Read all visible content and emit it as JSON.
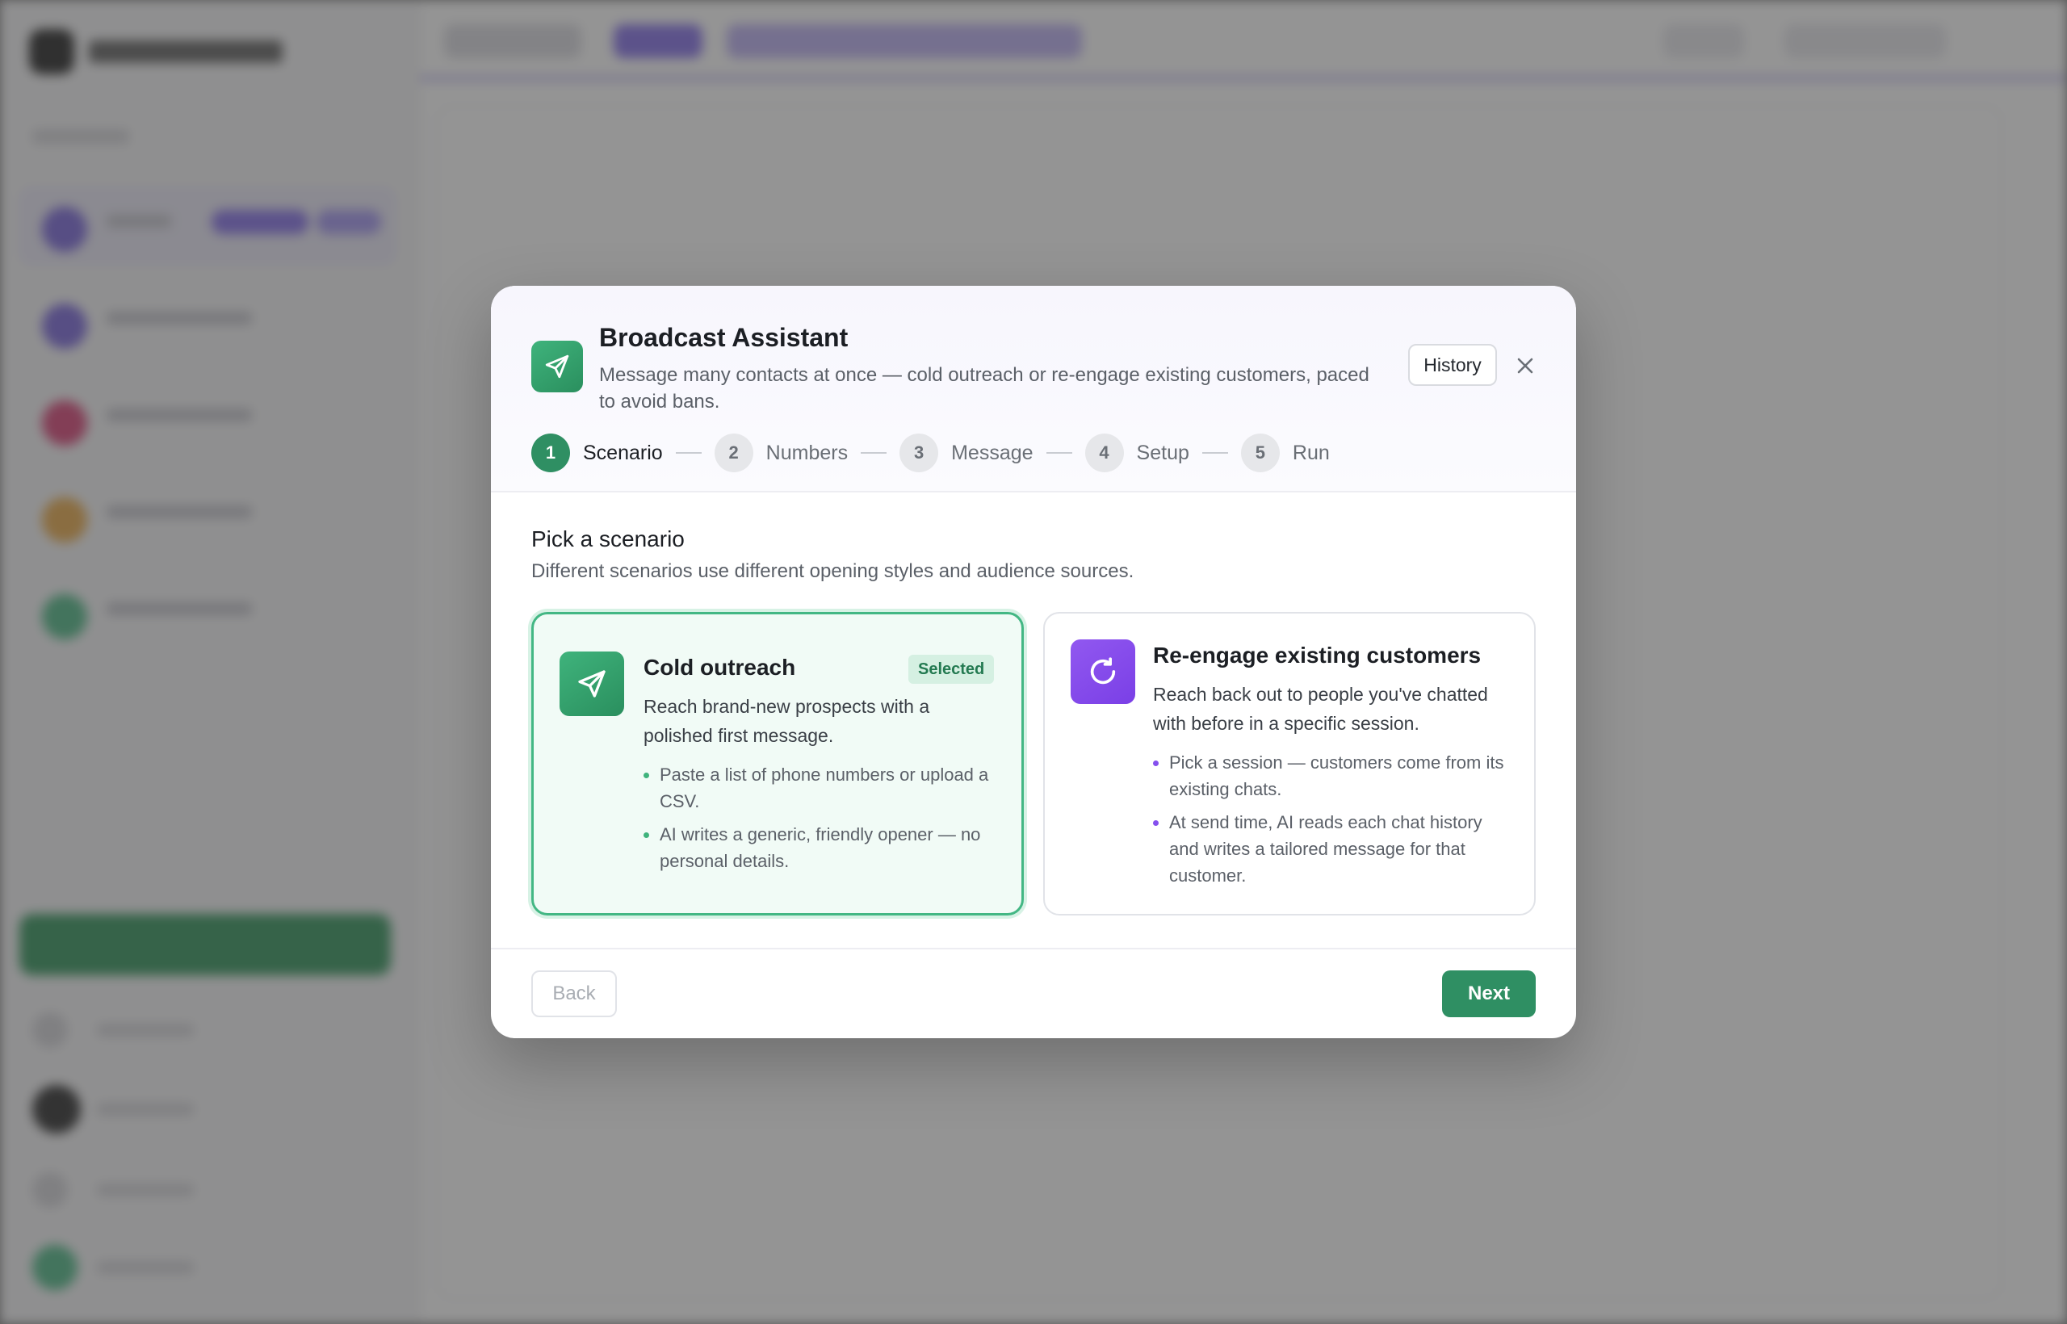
{
  "modal": {
    "title": "Broadcast Assistant",
    "subtitle": "Message many contacts at once — cold outreach or re-engage existing customers, paced to avoid bans.",
    "icon": "send-icon",
    "history_label": "History",
    "close_icon": "close-icon"
  },
  "steps": [
    {
      "number": "1",
      "label": "Scenario",
      "active": true
    },
    {
      "number": "2",
      "label": "Numbers",
      "active": false
    },
    {
      "number": "3",
      "label": "Message",
      "active": false
    },
    {
      "number": "4",
      "label": "Setup",
      "active": false
    },
    {
      "number": "5",
      "label": "Run",
      "active": false
    }
  ],
  "section": {
    "title": "Pick a scenario",
    "description": "Different scenarios use different opening styles and audience sources."
  },
  "scenarios": [
    {
      "title": "Cold outreach",
      "icon": "send-icon",
      "badge": "Selected",
      "selected": true,
      "description": "Reach brand-new prospects with a polished first message.",
      "bullets": [
        "Paste a list of phone numbers or upload a CSV.",
        "AI writes a generic, friendly opener — no personal details."
      ]
    },
    {
      "title": "Re-engage existing customers",
      "icon": "refresh-icon",
      "selected": false,
      "description": "Reach back out to people you've chatted with before in a specific session.",
      "bullets": [
        "Pick a session — customers come from its existing chats.",
        "At send time, AI reads each chat history and writes a tailored message for that customer."
      ]
    }
  ],
  "footer": {
    "back_label": "Back",
    "next_label": "Next"
  },
  "colors": {
    "accent_green": "#2f8f63",
    "accent_purple": "#8550ee",
    "selected_bg": "#f1fbf6"
  }
}
